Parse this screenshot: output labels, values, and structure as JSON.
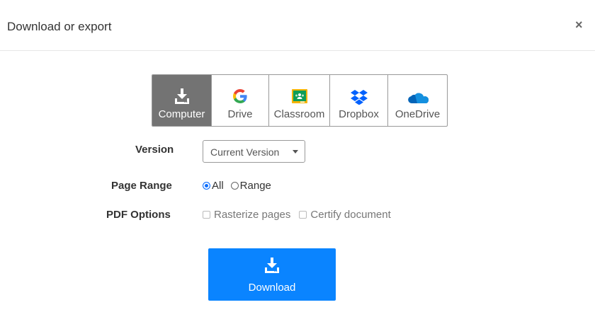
{
  "dialog": {
    "title": "Download or export",
    "close_label": "×"
  },
  "destinations": [
    {
      "label": "Computer",
      "icon": "download-icon",
      "active": true
    },
    {
      "label": "Drive",
      "icon": "google-drive-icon",
      "active": false
    },
    {
      "label": "Classroom",
      "icon": "google-classroom-icon",
      "active": false
    },
    {
      "label": "Dropbox",
      "icon": "dropbox-icon",
      "active": false
    },
    {
      "label": "OneDrive",
      "icon": "onedrive-icon",
      "active": false
    }
  ],
  "version": {
    "label": "Version",
    "value": "Current Version"
  },
  "page_range": {
    "label": "Page Range",
    "options": [
      {
        "label": "All",
        "checked": true
      },
      {
        "label": "Range",
        "checked": false
      }
    ]
  },
  "pdf_options": {
    "label": "PDF Options",
    "options": [
      {
        "label": "Rasterize pages",
        "checked": false
      },
      {
        "label": "Certify document",
        "checked": false
      }
    ]
  },
  "download_button": {
    "label": "Download"
  },
  "colors": {
    "accent": "#0a84ff",
    "active_tab": "#737373",
    "google_blue": "#4285f4",
    "google_red": "#ea4335",
    "google_yellow": "#fbbc05",
    "google_green": "#34a853",
    "dropbox": "#0061fe",
    "onedrive": "#0364b8"
  }
}
